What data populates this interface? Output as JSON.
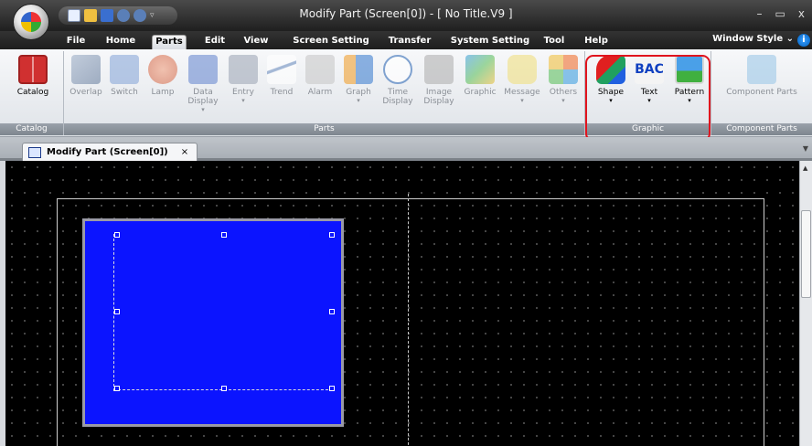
{
  "window": {
    "title": "Modify Part (Screen[0]) - [ No Title.V9 ]",
    "minimize": "–",
    "maximize": "▭",
    "close": "x"
  },
  "ribbon_tabs": [
    "File",
    "Home",
    "Parts",
    "Edit",
    "View",
    "Screen Setting",
    "Transfer",
    "System Setting",
    "Tool",
    "Help"
  ],
  "active_tab": "Parts",
  "window_style": "Window Style ⌄",
  "help_glyph": "i",
  "groups": {
    "catalog": {
      "label": "Catalog",
      "buttons": [
        {
          "label": "Catalog",
          "icon": "book-icon"
        }
      ]
    },
    "parts": {
      "label": "Parts",
      "buttons": [
        {
          "label": "Overlap",
          "icon": "overlap-icon"
        },
        {
          "label": "Switch",
          "icon": "switch-icon"
        },
        {
          "label": "Lamp",
          "icon": "lamp-icon"
        },
        {
          "label": "Data Display",
          "icon": "data-display-icon"
        },
        {
          "label": "Entry",
          "icon": "entry-icon"
        },
        {
          "label": "Trend",
          "icon": "trend-icon"
        },
        {
          "label": "Alarm",
          "icon": "alarm-icon"
        },
        {
          "label": "Graph",
          "icon": "graph-icon"
        },
        {
          "label": "Time Display",
          "icon": "clock-icon"
        },
        {
          "label": "Image Display",
          "icon": "camera-icon"
        },
        {
          "label": "Graphic",
          "icon": "graphic-icon"
        },
        {
          "label": "Message",
          "icon": "message-icon"
        },
        {
          "label": "Others",
          "icon": "others-icon"
        }
      ]
    },
    "graphic": {
      "label": "Graphic",
      "buttons": [
        {
          "label": "Shape",
          "icon": "shape-icon"
        },
        {
          "label": "Text",
          "icon": "text-icon"
        },
        {
          "label": "Pattern",
          "icon": "pattern-icon"
        }
      ]
    },
    "component_parts": {
      "label": "Component Parts",
      "buttons": [
        {
          "label": "Component Parts",
          "icon": "puzzle-icon"
        }
      ]
    }
  },
  "document_tab": {
    "label": "Modify Part (Screen[0])",
    "close": "×"
  },
  "colors": {
    "part_fill": "#0b14ff",
    "highlight": "#e0141e"
  }
}
